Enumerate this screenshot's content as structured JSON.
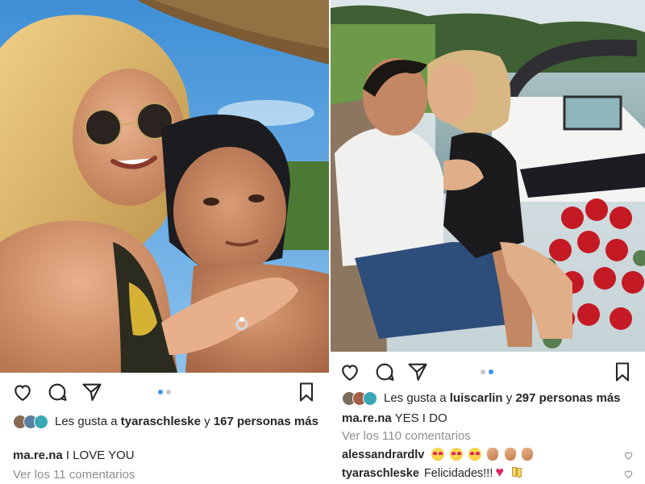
{
  "left_post": {
    "image_alt": "selfie",
    "active_dot": 1,
    "dot_count": 2,
    "liked_by_prefix": "Les gusta a",
    "liked_by_user": "tyaraschleske",
    "liked_by_suffix_and": "y",
    "liked_by_count": "167 personas más",
    "caption_user": "ma.re.na",
    "caption_text": "I LOVE YOU",
    "view_comments": "Ver los 11 comentarios"
  },
  "right_post": {
    "image_alt": "kiss on boat dock",
    "active_dot": 2,
    "dot_count": 2,
    "liked_by_prefix": "Les gusta a",
    "liked_by_user": "luiscarlin",
    "liked_by_suffix_and": "y",
    "liked_by_count": "297 personas más",
    "caption_user": "ma.re.na",
    "caption_text": "YES I DO",
    "view_comments": "Ver los 110 comentarios",
    "comments": [
      {
        "user": "alessandrardlv",
        "text": "",
        "emojis": [
          "heart-eyes-icon",
          "heart-eyes-icon",
          "heart-eyes-icon",
          "clap-icon",
          "clap-icon",
          "clap-icon"
        ]
      },
      {
        "user": "tyaraschleske",
        "text": "Felicidades!!!",
        "emojis": [
          "red-heart-icon",
          "champagne-icon"
        ]
      }
    ]
  },
  "icons": {
    "like": "heart-icon",
    "comment": "comment-bubble-icon",
    "share": "paper-plane-icon",
    "save": "bookmark-icon"
  },
  "colors": {
    "active_dot": "#3897f0",
    "inactive_dot": "#c7c7c7",
    "text": "#262626",
    "muted": "#8e8e8e"
  }
}
